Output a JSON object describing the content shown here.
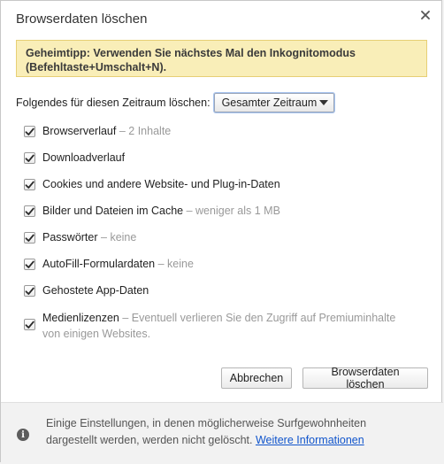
{
  "dialog": {
    "title": "Browserdaten löschen",
    "tip": "Geheimtipp: Verwenden Sie nächstes Mal den Inkognitomodus (Befehltaste+Umschalt+N).",
    "range_label": "Folgendes für diesen Zeitraum löschen:",
    "range_value": "Gesamter Zeitraum",
    "items": [
      {
        "label": "Browserverlauf",
        "detail": "– 2 Inhalte",
        "checked": true
      },
      {
        "label": "Downloadverlauf",
        "detail": "",
        "checked": true
      },
      {
        "label": "Cookies und andere Website- und Plug-in-Daten",
        "detail": "",
        "checked": true
      },
      {
        "label": "Bilder und Dateien im Cache",
        "detail": "– weniger als 1 MB",
        "checked": true
      },
      {
        "label": "Passwörter",
        "detail": "– keine",
        "checked": true
      },
      {
        "label": "AutoFill-Formulardaten",
        "detail": "– keine",
        "checked": true
      },
      {
        "label": "Gehostete App-Daten",
        "detail": "",
        "checked": true
      },
      {
        "label": "Medienlizenzen",
        "detail": "– Eventuell verlieren Sie den Zugriff auf Premiuminhalte von einigen Websites.",
        "checked": true
      }
    ],
    "cancel_label": "Abbrechen",
    "confirm_label": "Browserdaten löschen"
  },
  "footer": {
    "text": "Einige Einstellungen, in denen möglicherweise Surfgewohnheiten dargestellt werden, werden nicht gelöscht.",
    "link": "Weitere Informationen",
    "icon": "info-icon"
  },
  "colors": {
    "tip_bg": "#f9eeb8",
    "tip_border": "#e7cf75",
    "link": "#1155cc",
    "detail_text": "#999999"
  }
}
